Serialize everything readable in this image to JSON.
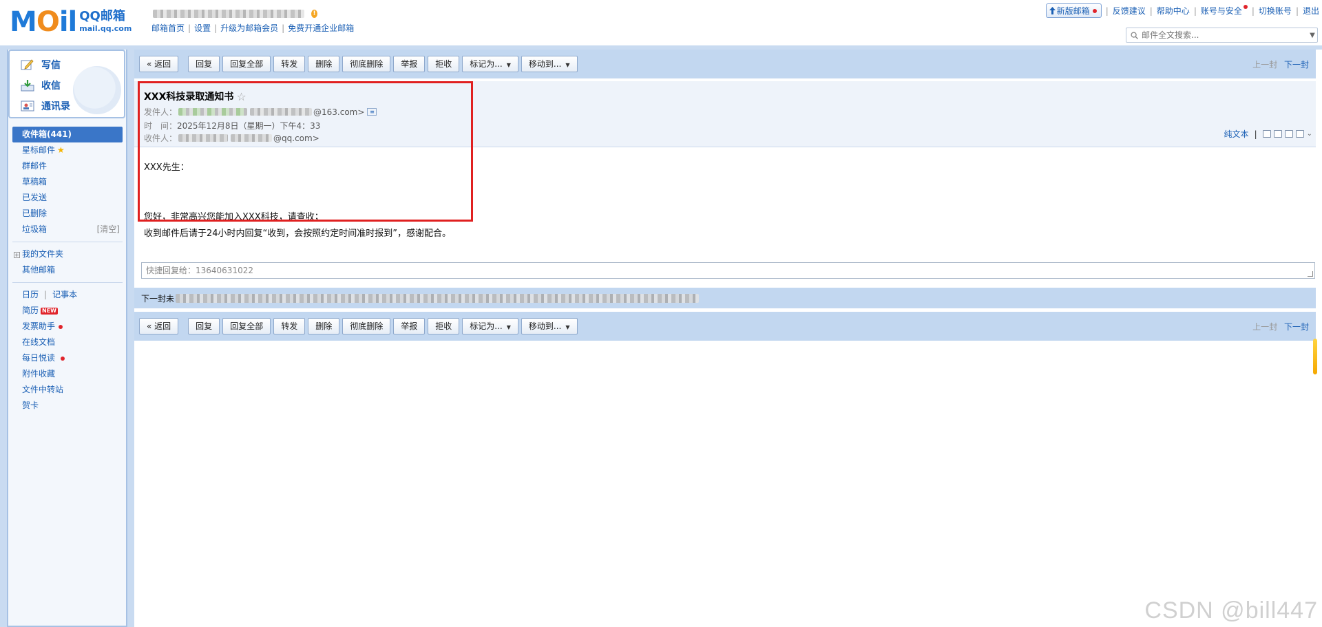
{
  "header": {
    "logo_text_m": "M",
    "logo_text_o": "O",
    "logo_text_il": "il",
    "logo_product": "QQ邮箱",
    "logo_domain": "mail.qq.com",
    "warn_badge": "!",
    "links": [
      "邮箱首页",
      "设置",
      "升级为邮箱会员",
      "免费开通企业邮箱"
    ],
    "right_links": {
      "new_version": "新版邮箱",
      "feedback": "反馈建议",
      "help": "帮助中心",
      "account_security": "账号与安全",
      "switch_account": "切换账号",
      "logout": "退出"
    },
    "search_placeholder": "邮件全文搜索..."
  },
  "quick_actions": {
    "compose": "写信",
    "receive": "收信",
    "contacts": "通讯录"
  },
  "folders": {
    "inbox": "收件箱(441)",
    "starred": "星标邮件",
    "group": "群邮件",
    "drafts": "草稿箱",
    "sent": "已发送",
    "deleted": "已删除",
    "spam": "垃圾箱",
    "spam_clear": "[清空]",
    "my_folders": "我的文件夹",
    "other_mailbox": "其他邮箱",
    "calendar": "日历",
    "notepad": "记事本",
    "resume": "简历",
    "resume_badge": "NEW",
    "invoice": "发票助手",
    "docs": "在线文档",
    "daily": "每日悦读",
    "attachments": "附件收藏",
    "transfer": "文件中转站",
    "cards": "贺卡"
  },
  "toolbar": {
    "back": "« 返回",
    "reply": "回复",
    "reply_all": "回复全部",
    "forward": "转发",
    "delete": "删除",
    "delete_forever": "彻底删除",
    "report": "举报",
    "reject": "拒收",
    "mark_as": "标记为...",
    "move_to": "移动到...",
    "prev": "上一封",
    "next": "下一封"
  },
  "mail": {
    "subject": "XXX科技录取通知书",
    "from_label": "发件人：",
    "from_domain": "@163.com>",
    "time_label": "时　间：",
    "time_value": "2025年12月8日（星期一）下午4：33",
    "to_label": "收件人：",
    "to_domain": "@qq.com>",
    "plain_text": "纯文本",
    "body_greeting": "XXX先生：",
    "body_line1": "您好，非常高兴您能加入XXX科技，请查收；",
    "body_line2": "收到邮件后请于24小时内回复“收到，会按照约定时间准时报到”，感谢配合。"
  },
  "quick_reply_placeholder": "快捷回复给：13640631022",
  "next_mail_label": "下一封未",
  "watermark": "CSDN @bill447",
  "colors": {
    "accent": "#1a5fb4",
    "toolbar_bg": "#c2d7f0",
    "highlight_box": "#e02020",
    "active_folder": "#3a76c8"
  }
}
